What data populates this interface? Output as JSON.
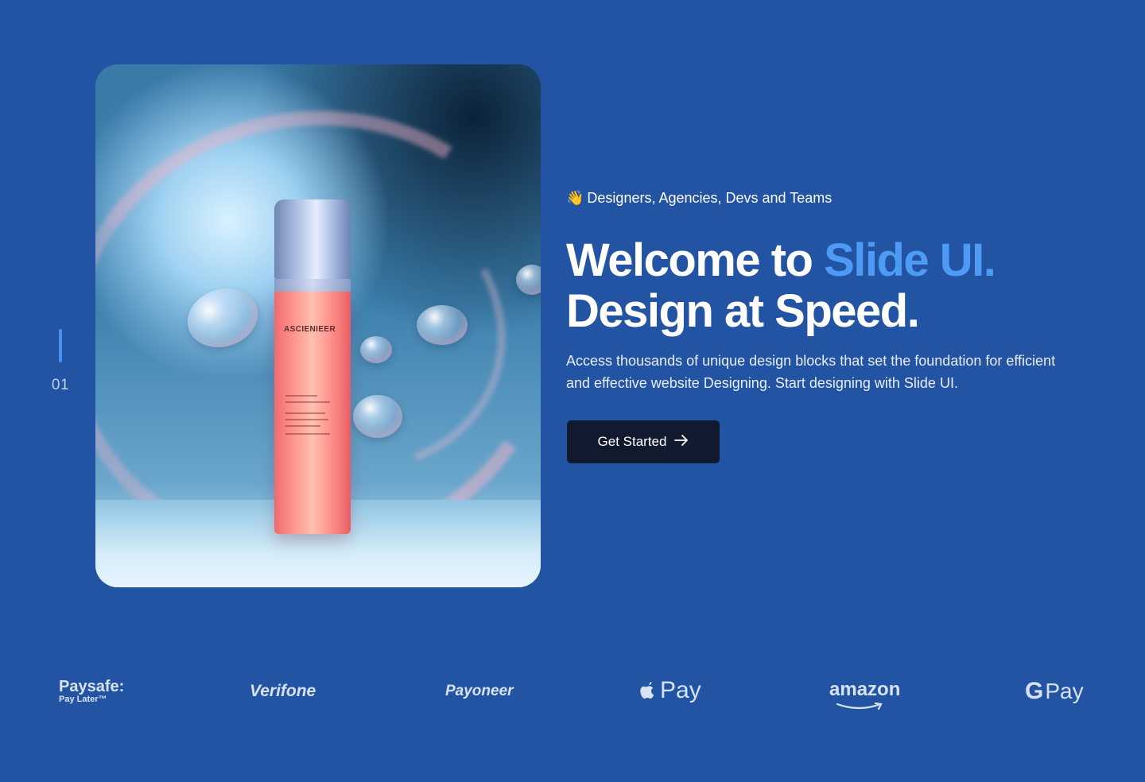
{
  "slide": {
    "number": "01"
  },
  "hero": {
    "product_label": "ASCIENIEER",
    "tagline_emoji": "👋",
    "tagline": "Designers, Agencies, Devs and Teams",
    "headline_part1": "Welcome to ",
    "headline_accent": "Slide UI.",
    "headline_line2": "Design at Speed.",
    "description": "Access thousands of unique design blocks that set the foundation for efficient and effective website Designing. Start designing with Slide UI.",
    "cta_label": "Get Started",
    "cta_icon": "arrow-right-icon"
  },
  "logos": {
    "paysafe": {
      "main": "Paysafe:",
      "sub": "Pay Later™"
    },
    "verifone": "Verifone",
    "payoneer": "Payoneer",
    "applepay": "Pay",
    "amazon": "amazon",
    "gpay": "Pay"
  },
  "colors": {
    "background": "#2354a3",
    "accent": "#4d9bf5",
    "button": "#111a2e",
    "indicator": "#4a90f0"
  }
}
